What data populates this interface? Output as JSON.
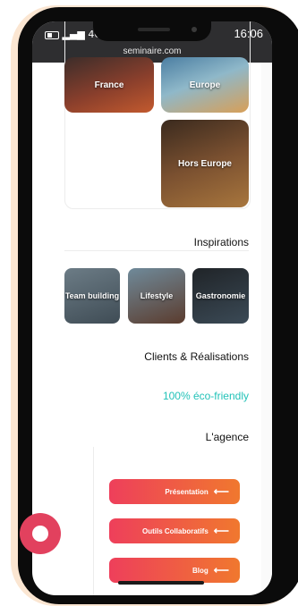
{
  "status_bar": {
    "time": "16:06",
    "carrier": "4G",
    "signal": "▂▄▆"
  },
  "browser": {
    "url": "seminaire.com"
  },
  "destinations": {
    "tiles": [
      {
        "label": "France"
      },
      {
        "label": "Europe"
      },
      {
        "label": "Hors Europe"
      }
    ]
  },
  "inspirations": {
    "heading": "Inspirations",
    "items": [
      {
        "label": "Team building"
      },
      {
        "label": "Lifestyle"
      },
      {
        "label": "Gastronomie"
      }
    ]
  },
  "clients": {
    "heading": "Clients & Réalisations"
  },
  "eco": {
    "label": "100% éco-friendly",
    "color": "#22c2b8"
  },
  "agence": {
    "heading": "L'agence",
    "links": [
      {
        "label": "Présentation"
      },
      {
        "label": "Outils Collaboratifs"
      },
      {
        "label": "Blog"
      }
    ]
  },
  "colors": {
    "accent": "#ee3f5b",
    "accent2": "#f0782e",
    "chat": "#e2415e"
  }
}
